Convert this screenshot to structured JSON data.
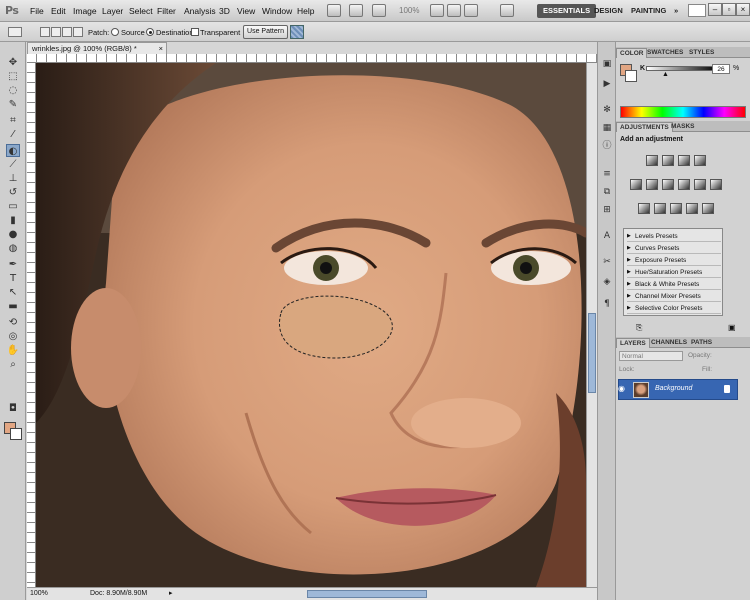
{
  "app": {
    "logo": "Ps"
  },
  "menu": {
    "items": [
      "File",
      "Edit",
      "Image",
      "Layer",
      "Select",
      "Filter",
      "Analysis",
      "3D",
      "View",
      "Window",
      "Help"
    ]
  },
  "menubar": {
    "zoom": "100%"
  },
  "workspaces": {
    "items": [
      "ESSENTIALS",
      "DESIGN",
      "PAINTING"
    ],
    "more": "»",
    "active": "ESSENTIALS"
  },
  "options": {
    "patch_label": "Patch:",
    "source_label": "Source",
    "destination_label": "Destination",
    "transparent_label": "Transparent",
    "use_pattern_label": "Use Pattern",
    "patch_mode": "Destination"
  },
  "document": {
    "tab_title": "wrinkles.jpg @ 100% (RGB/8) *",
    "zoom": "100%",
    "doc_size": "Doc: 8.90M/8.90M"
  },
  "color_panel": {
    "tabs": [
      "COLOR",
      "SWATCHES",
      "STYLES"
    ],
    "channel_label": "K",
    "channel_value": "26",
    "channel_unit": "%",
    "foreground_color": "#e2a683"
  },
  "adjustments_panel": {
    "tabs": [
      "ADJUSTMENTS",
      "MASKS"
    ],
    "heading": "Add an adjustment",
    "presets": [
      "Levels Presets",
      "Curves Presets",
      "Exposure Presets",
      "Hue/Saturation Presets",
      "Black & White Presets",
      "Channel Mixer Presets",
      "Selective Color Presets"
    ]
  },
  "layers_panel": {
    "tabs": [
      "LAYERS",
      "CHANNELS",
      "PATHS"
    ],
    "blend_mode": "Normal",
    "opacity_label": "Opacity:",
    "fill_label": "Fill:",
    "lock_label": "Lock:",
    "layers": [
      {
        "name": "Background",
        "selected": true
      }
    ]
  },
  "colors": {
    "accent": "#3766b2",
    "patch_fill": "#d9a77f",
    "skin": "#dba27f"
  }
}
